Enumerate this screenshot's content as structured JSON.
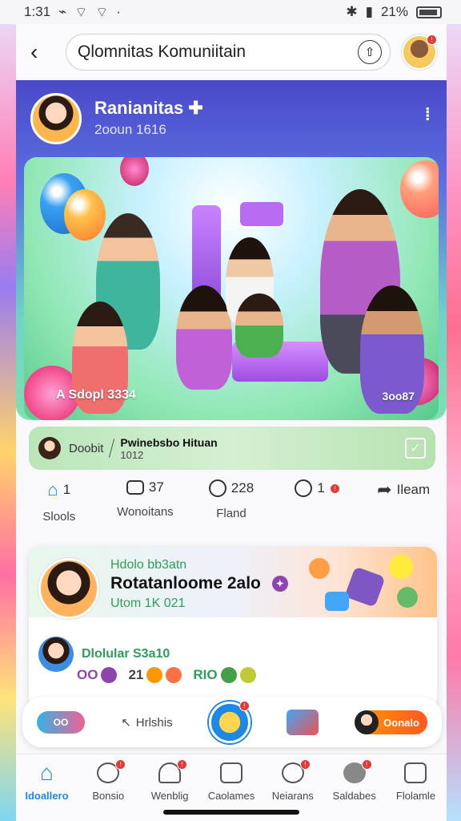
{
  "status_bar": {
    "time": "1:31",
    "battery": "21%"
  },
  "topbar": {
    "search_text": "Qlomnitas Komuniitain"
  },
  "hero": {
    "name": "Ranianitas",
    "sub": "2ooun 1616",
    "caption_left": "A Sdopl 3334",
    "caption_right": "3oo87"
  },
  "info_strip": {
    "label": "Doobit",
    "title": "Pwinebsbo Hituan",
    "sub": "1012"
  },
  "stats": [
    {
      "count": "1",
      "label": "Slools",
      "icon": "home-icon"
    },
    {
      "count": "37",
      "label": "Wonoitans",
      "icon": "comment-icon"
    },
    {
      "count": "228",
      "label": "Fland",
      "icon": "bubble-icon"
    },
    {
      "count": "1",
      "label": "",
      "icon": "reaction-icon"
    },
    {
      "count": "Ileam",
      "label": "",
      "icon": "share-icon"
    }
  ],
  "post": {
    "kicker": "Hdolo bb3atn",
    "title": "Rotatanloome 2alo",
    "meta": "Utom 1K 021",
    "comment_name": "Dlolular S3a10",
    "emoji": [
      "OO",
      "21",
      "RIO"
    ]
  },
  "reaction_bar": {
    "pill_text": "OO",
    "text": "Hrlshis",
    "orange_text": "Oonalo"
  },
  "bottom_nav": [
    {
      "label": "Idoallero",
      "active": true
    },
    {
      "label": "Bonsio",
      "active": false
    },
    {
      "label": "Wenblig",
      "active": false
    },
    {
      "label": "Caolames",
      "active": false
    },
    {
      "label": "Neiarans",
      "active": false
    },
    {
      "label": "Saldabes",
      "active": false
    },
    {
      "label": "Flolamle",
      "active": false
    }
  ],
  "colors": {
    "accent": "#1e88e5",
    "badge": "#e53935",
    "positive": "#2e9e5b"
  }
}
